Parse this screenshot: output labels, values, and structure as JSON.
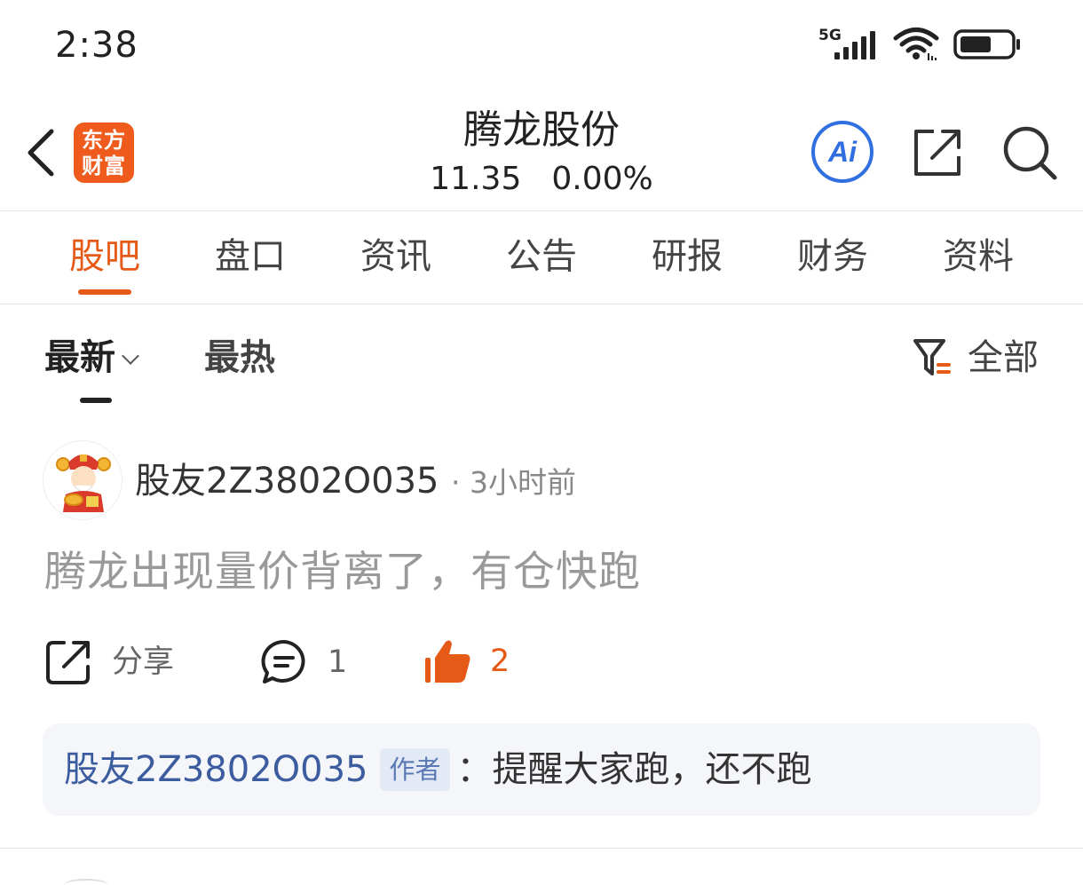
{
  "status_bar": {
    "time": "2:38",
    "network": "5G",
    "icons": [
      "signal-icon",
      "wifi-icon",
      "battery-icon"
    ]
  },
  "header": {
    "logo_line1": "东方",
    "logo_line2": "财富",
    "stock_name": "腾龙股份",
    "price": "11.35",
    "change": "0.00%",
    "ai_label": "Ai",
    "brand_color": "#ef5b1c",
    "ai_color": "#2f6fe0"
  },
  "tabs": [
    {
      "label": "股吧",
      "active": true
    },
    {
      "label": "盘口",
      "active": false
    },
    {
      "label": "资讯",
      "active": false
    },
    {
      "label": "公告",
      "active": false
    },
    {
      "label": "研报",
      "active": false
    },
    {
      "label": "财务",
      "active": false
    },
    {
      "label": "资料",
      "active": false
    }
  ],
  "sort": {
    "latest": "最新",
    "hot": "最热",
    "filter": "全部"
  },
  "post": {
    "username": "股友2Z3802O035",
    "time": "· 3小时前",
    "content": "腾龙出现量价背离了，有仓快跑",
    "share_label": "分享",
    "comment_count": "1",
    "like_count": "2",
    "reply": {
      "user": "股友2Z3802O035",
      "tag": "作者",
      "text": "：提醒大家跑，还不跑"
    }
  },
  "accent_color": "#e55a17"
}
